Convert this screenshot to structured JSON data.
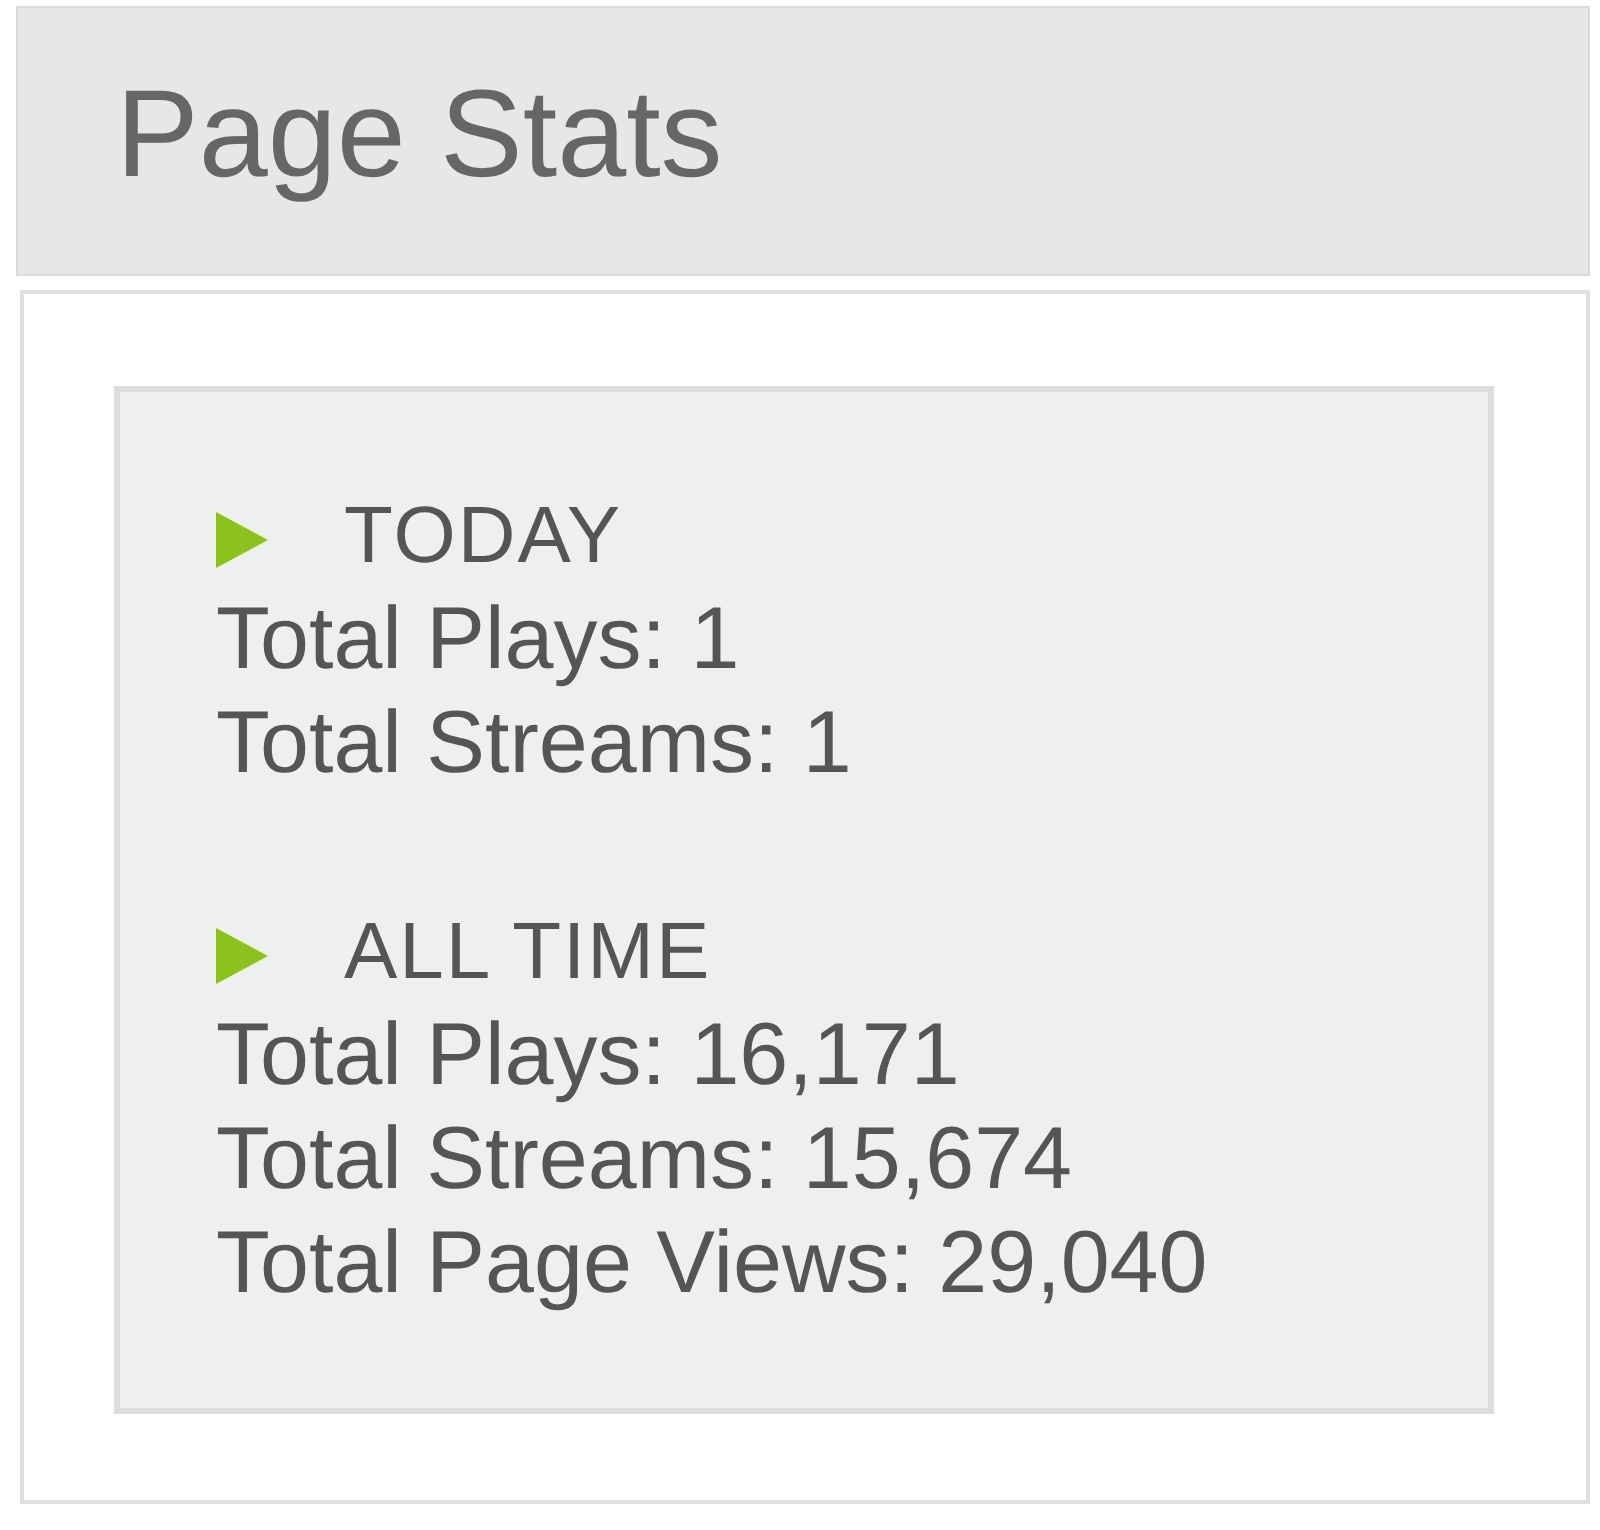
{
  "panel": {
    "title": "Page Stats"
  },
  "sections": [
    {
      "heading": "TODAY",
      "stats": [
        "Total Plays: 1",
        "Total Streams: 1"
      ]
    },
    {
      "heading": "ALL TIME",
      "stats": [
        "Total Plays: 16,171",
        "Total Streams: 15,674",
        "Total Page Views: 29,040"
      ]
    }
  ]
}
